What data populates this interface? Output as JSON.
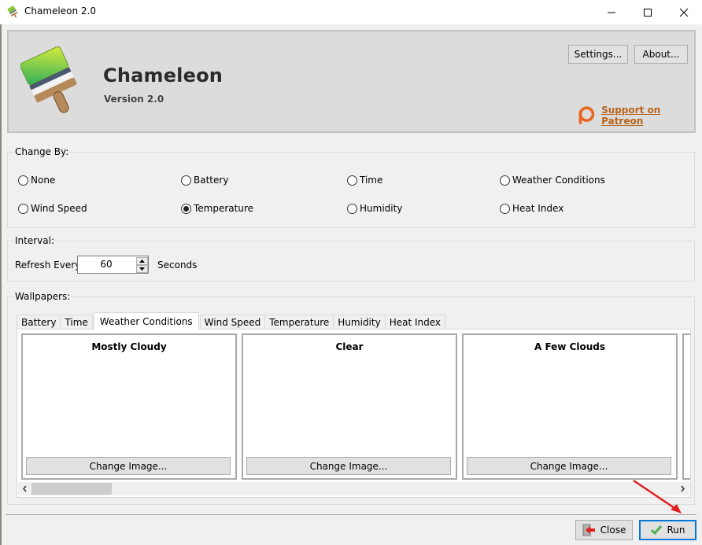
{
  "window": {
    "title": "Chameleon 2.0",
    "controls": [
      "minimize",
      "maximize",
      "close"
    ]
  },
  "header": {
    "app_name": "Chameleon",
    "version": "Version 2.0",
    "settings_label": "Settings...",
    "about_label": "About...",
    "patreon_label": "Support on Patreon",
    "patreon_color": "#e8671e",
    "link_color": "#b8651e"
  },
  "change_by": {
    "label": "Change By:",
    "selected": "Temperature",
    "options": [
      {
        "label": "None",
        "checked": false
      },
      {
        "label": "Battery",
        "checked": false
      },
      {
        "label": "Time",
        "checked": false
      },
      {
        "label": "Weather Conditions",
        "checked": false
      },
      {
        "label": "Wind Speed",
        "checked": false
      },
      {
        "label": "Temperature",
        "checked": true
      },
      {
        "label": "Humidity",
        "checked": false
      },
      {
        "label": "Heat Index",
        "checked": false
      }
    ]
  },
  "interval": {
    "label": "Interval:",
    "refresh_label": "Refresh Every",
    "value": "60",
    "unit": "Seconds"
  },
  "wallpapers": {
    "label": "Wallpapers:",
    "active_tab": "Weather Conditions",
    "tabs": [
      "Battery",
      "Time",
      "Weather Conditions",
      "Wind Speed",
      "Temperature",
      "Humidity",
      "Heat Index"
    ],
    "cards": [
      {
        "title": "Mostly Cloudy",
        "button": "Change Image..."
      },
      {
        "title": "Clear",
        "button": "Change Image..."
      },
      {
        "title": "A Few Clouds",
        "button": "Change Image..."
      }
    ]
  },
  "footer": {
    "close_label": "Close",
    "run_label": "Run",
    "focus_color": "#0078d7",
    "annotation_arrow_color": "#e02020"
  }
}
